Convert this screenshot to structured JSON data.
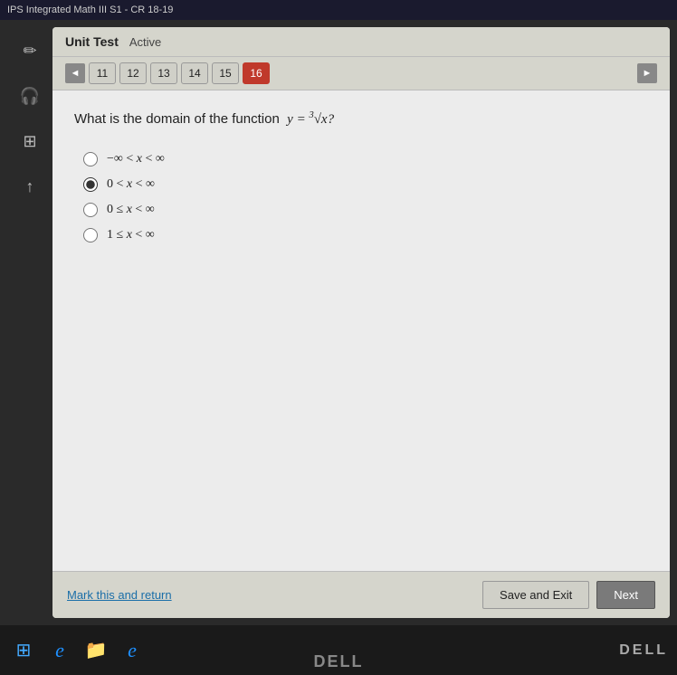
{
  "topBar": {
    "title": "IPS Integrated Math III S1 - CR 18-19"
  },
  "header": {
    "title": "Unit Test",
    "status": "Active"
  },
  "navigation": {
    "prevArrow": "◄",
    "nextArrow": "►",
    "buttons": [
      {
        "label": "11",
        "active": false
      },
      {
        "label": "12",
        "active": false
      },
      {
        "label": "13",
        "active": false
      },
      {
        "label": "14",
        "active": false
      },
      {
        "label": "15",
        "active": false
      },
      {
        "label": "16",
        "active": true
      }
    ]
  },
  "question": {
    "text": "What is the domain of the function",
    "mathExpression": "y = ∛x?",
    "options": [
      {
        "id": "opt1",
        "label": "-∞ < x < ∞",
        "selected": false
      },
      {
        "id": "opt2",
        "label": "0 < x < ∞",
        "selected": true
      },
      {
        "id": "opt3",
        "label": "0 ≤ x < ∞",
        "selected": false
      },
      {
        "id": "opt4",
        "label": "1 ≤ x < ∞",
        "selected": false
      }
    ]
  },
  "footer": {
    "markReturn": "Mark this and return",
    "saveExit": "Save and Exit",
    "next": "Next"
  },
  "sidebar": {
    "icons": [
      {
        "name": "pencil-icon",
        "symbol": "✏"
      },
      {
        "name": "headphones-icon",
        "symbol": "🎧"
      },
      {
        "name": "grid-icon",
        "symbol": "⊞"
      },
      {
        "name": "up-arrow-icon",
        "symbol": "↑"
      }
    ]
  },
  "taskbar": {
    "icons": [
      {
        "name": "start-icon",
        "symbol": "⊞"
      },
      {
        "name": "internet-explorer-icon",
        "symbol": "e"
      },
      {
        "name": "folder-icon",
        "symbol": "📁"
      },
      {
        "name": "browser-icon",
        "symbol": "e"
      }
    ]
  },
  "dellLogo": "DELL"
}
